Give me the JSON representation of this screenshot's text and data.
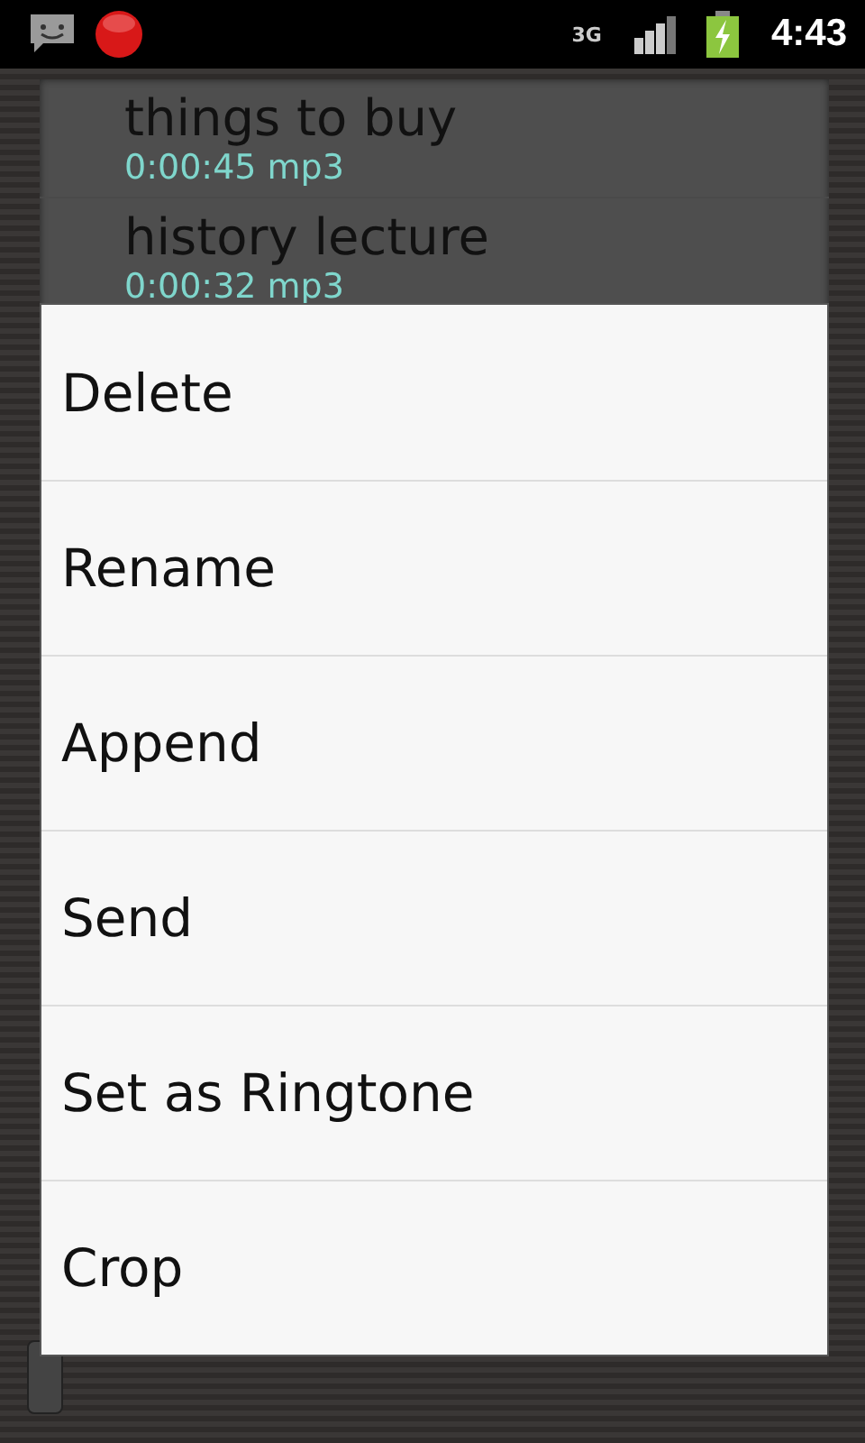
{
  "status_bar": {
    "time": "4:43",
    "network": "3G"
  },
  "recordings": [
    {
      "title": "things to buy",
      "details": "0:00:45 mp3"
    },
    {
      "title": "history lecture",
      "details": "0:00:32 mp3"
    }
  ],
  "context_menu": {
    "items": [
      {
        "label": "Delete"
      },
      {
        "label": "Rename"
      },
      {
        "label": "Append"
      },
      {
        "label": "Send"
      },
      {
        "label": "Set as Ringtone"
      },
      {
        "label": "Crop"
      }
    ]
  }
}
